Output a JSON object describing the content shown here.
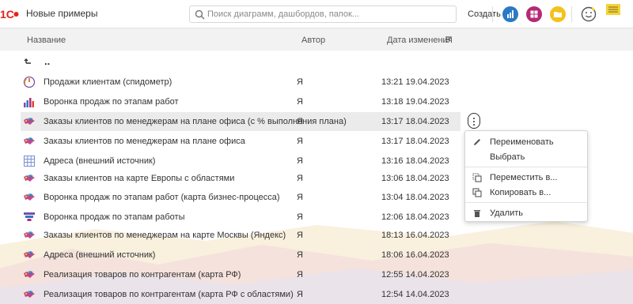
{
  "header": {
    "app_title": "Новые примеры",
    "search_placeholder": "Поиск диаграмм, дашбордов, папок...",
    "create_label": "Создать",
    "colors": {
      "blue": "#2b78c5",
      "purple": "#b52a74",
      "yellow": "#f3c21b",
      "logo_red": "#e2231a"
    }
  },
  "columns": {
    "name": "Название",
    "author": "Автор",
    "date": "Дата изменения"
  },
  "up_label": "..",
  "rows": [
    {
      "icon": "speedometer-icon",
      "name": "Продажи клиентам (спидометр)",
      "author": "Я",
      "date": "13:21 19.04.2023"
    },
    {
      "icon": "bar-chart-icon",
      "name": "Воронка продаж по этапам работ",
      "author": "Я",
      "date": "13:18 19.04.2023"
    },
    {
      "icon": "map-icon",
      "name": "Заказы клиентов по менеджерам на плане офиса (с % выполнения плана)",
      "author": "Я",
      "date": "13:17 18.04.2023"
    },
    {
      "icon": "map-icon",
      "name": "Заказы клиентов по менеджерам на плане офиса",
      "author": "Я",
      "date": "13:17 18.04.2023"
    },
    {
      "icon": "table-icon",
      "name": "Адреса (внешний источник)",
      "author": "Я",
      "date": "13:16 18.04.2023"
    },
    {
      "icon": "map-icon",
      "name": "Заказы клиентов на карте Европы с областями",
      "author": "Я",
      "date": "13:06 18.04.2023"
    },
    {
      "icon": "map-icon",
      "name": "Воронка продаж по этапам работ (карта бизнес-процесса)",
      "author": "Я",
      "date": "13:04 18.04.2023"
    },
    {
      "icon": "funnel-icon",
      "name": "Воронка продаж по этапам работы",
      "author": "Я",
      "date": "12:06 18.04.2023"
    },
    {
      "icon": "map-icon",
      "name": "Заказы клиентов по менеджерам на карте Москвы (Яндекс)",
      "author": "Я",
      "date": "18:13 16.04.2023"
    },
    {
      "icon": "map-icon",
      "name": "Адреса (внешний источник)",
      "author": "Я",
      "date": "18:06 16.04.2023"
    },
    {
      "icon": "map-icon",
      "name": "Реализация товаров по контрагентам (карта РФ)",
      "author": "Я",
      "date": "12:55 14.04.2023"
    },
    {
      "icon": "map-icon",
      "name": "Реализация товаров по контрагентам (карта РФ  с областями)",
      "author": "Я",
      "date": "12:54 14.04.2023"
    }
  ],
  "context_menu": {
    "rename": "Переименовать",
    "select": "Выбрать",
    "move": "Переместить в...",
    "copy": "Копировать в...",
    "delete": "Удалить"
  }
}
